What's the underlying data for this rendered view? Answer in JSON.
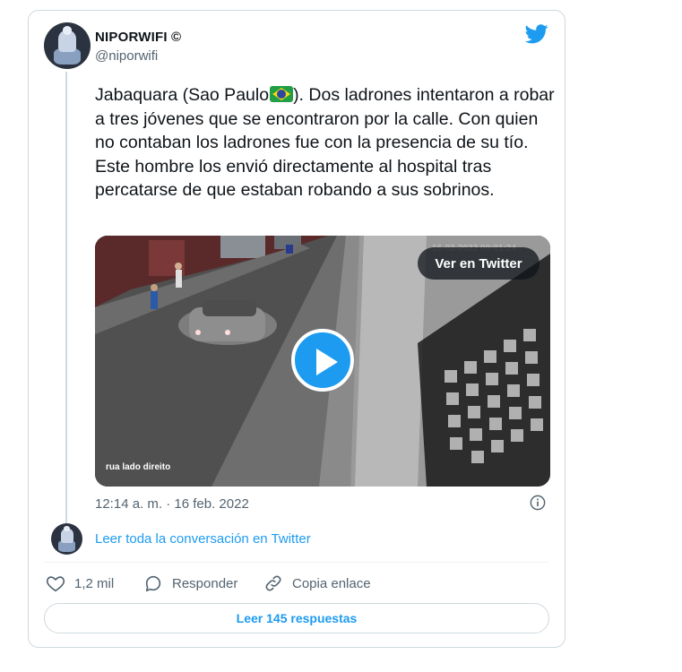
{
  "tweet": {
    "author_name": "NIPORWIFI ©",
    "author_handle": "@niporwifi",
    "text_before_flag": "Jabaquara (Sao Paulo",
    "text_after_flag": "). Dos ladrones intentaron a robar a tres jóvenes que se encontraron por la calle. Con quien no contaban los ladrones fue con la presencia de su tío. Este hombre los envió directamente al hospital tras percatarse de que estaban robando a sus sobrinos.",
    "timestamp": "12:14 a. m. · 16 feb. 2022"
  },
  "video": {
    "watch_button": "Ver en Twitter",
    "camera_label": "rua lado direito",
    "camera_timestamp": "16-02-2022 00:01:24"
  },
  "conversation_link": "Leer toda la conversación en Twitter",
  "actions": {
    "likes": "1,2 mil",
    "reply": "Responder",
    "copy_link": "Copia enlace"
  },
  "replies_button": "Leer 145 respuestas",
  "icons": {
    "brand": "twitter-bird-icon",
    "flag": "brazil-flag-icon",
    "play": "play-icon",
    "info": "info-icon",
    "like": "heart-icon",
    "reply": "speech-bubble-icon",
    "copy": "link-icon"
  },
  "colors": {
    "accent": "#1d9bf0",
    "text": "#0f1419",
    "muted": "#536471",
    "border": "#cfd9de"
  }
}
